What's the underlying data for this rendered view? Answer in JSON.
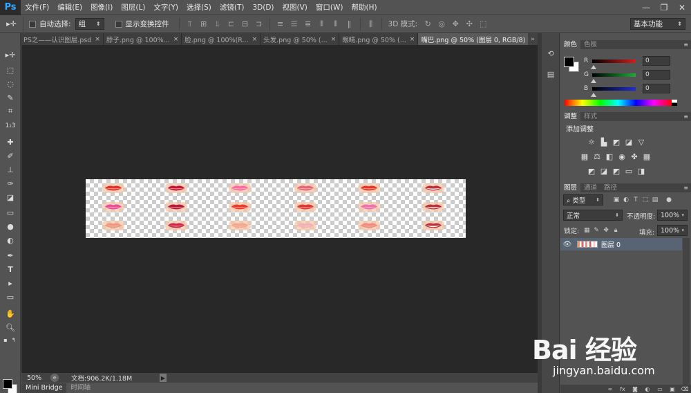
{
  "app": {
    "logo": "Ps"
  },
  "menu": [
    "文件(F)",
    "编辑(E)",
    "图像(I)",
    "图层(L)",
    "文字(Y)",
    "选择(S)",
    "滤镜(T)",
    "3D(D)",
    "视图(V)",
    "窗口(W)",
    "帮助(H)"
  ],
  "window_controls": {
    "minimize": "—",
    "restore": "❐",
    "close": "✕"
  },
  "options": {
    "auto_select_label": "自动选择:",
    "auto_select_value": "组",
    "show_transform_label": "显示变换控件",
    "mode_3d_label": "3D 模式:",
    "workspace": "基本功能"
  },
  "tabs": [
    {
      "label": "PS之——认识图层.psd",
      "active": false
    },
    {
      "label": "脖子.png @ 100%...",
      "active": false
    },
    {
      "label": "脸.png @ 100%(R...",
      "active": false
    },
    {
      "label": "头发.png @ 50% (...",
      "active": false
    },
    {
      "label": "眼睛.png @ 50% (...",
      "active": false
    },
    {
      "label": "嘴巴.png @ 50% (图层 0, RGB/8) *",
      "active": true
    }
  ],
  "tab_close": "×",
  "tab_overflow": "»",
  "status": {
    "zoom": "50%",
    "doc": "文档:906.2K/1.18M",
    "arrow": "▶"
  },
  "bottom_tabs": [
    {
      "label": "Mini Bridge",
      "active": true
    },
    {
      "label": "时间轴",
      "active": false
    }
  ],
  "color_panel": {
    "tabs": [
      "颜色",
      "色板"
    ],
    "r_label": "R",
    "g_label": "G",
    "b_label": "B",
    "r_value": "0",
    "g_value": "0",
    "b_value": "0",
    "colors": {
      "r": "#d21f1f",
      "g": "#1faa3a",
      "b": "#1f2fcf"
    }
  },
  "adjust_panel": {
    "tabs": [
      "调整",
      "样式"
    ],
    "title": "添加调整"
  },
  "layers_panel": {
    "tabs": [
      "图层",
      "通道",
      "路径"
    ],
    "filter": "类型",
    "blend_mode": "正常",
    "opacity_label": "不透明度:",
    "opacity_value": "100%",
    "lock_label": "锁定:",
    "fill_label": "填充:",
    "fill_value": "100%",
    "layer_name": "图层 0"
  },
  "canvas": {
    "lip_colors": [
      [
        "#e2302b",
        "#c9143a",
        "#ff6aa4",
        "#e8647a",
        "#e8352a",
        "#ffffff"
      ],
      [
        "#ee4aa0",
        "#b8183a",
        "#f03a2a",
        "#e63333",
        "#f070b0",
        "#ffffff"
      ],
      [
        "#f0957e",
        "#d0224a",
        "#f7a58d",
        "#f5b0b5",
        "#f5887e",
        "#ffffff"
      ]
    ],
    "accent": "#31a8ff"
  },
  "watermark": {
    "logo": "Bai 经验",
    "url": "jingyan.baidu.com"
  }
}
